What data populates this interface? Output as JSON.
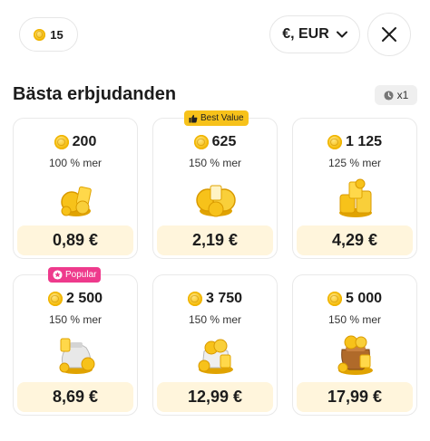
{
  "header": {
    "coin_balance": "15",
    "currency_label": "€, EUR",
    "close_icon": "close-icon"
  },
  "section": {
    "title": "Bästa erbjudanden",
    "timer_label": "x1"
  },
  "offers": [
    {
      "coins": "200",
      "bonus": "100 % mer",
      "price": "0,89 €",
      "badge": ""
    },
    {
      "coins": "625",
      "bonus": "150 % mer",
      "price": "2,19 €",
      "badge": "Best Value"
    },
    {
      "coins": "1 125",
      "bonus": "125 % mer",
      "price": "4,29 €",
      "badge": ""
    },
    {
      "coins": "2 500",
      "bonus": "150 % mer",
      "price": "8,69 €",
      "badge": "Popular"
    },
    {
      "coins": "3 750",
      "bonus": "150 % mer",
      "price": "12,99 €",
      "badge": ""
    },
    {
      "coins": "5 000",
      "bonus": "150 % mer",
      "price": "17,99 €",
      "badge": ""
    }
  ],
  "colors": {
    "coin": "#f7c21a",
    "price_bg": "#fff5dc",
    "best_value_badge": "#f7c21a",
    "popular_badge": "#ee3a8c"
  }
}
